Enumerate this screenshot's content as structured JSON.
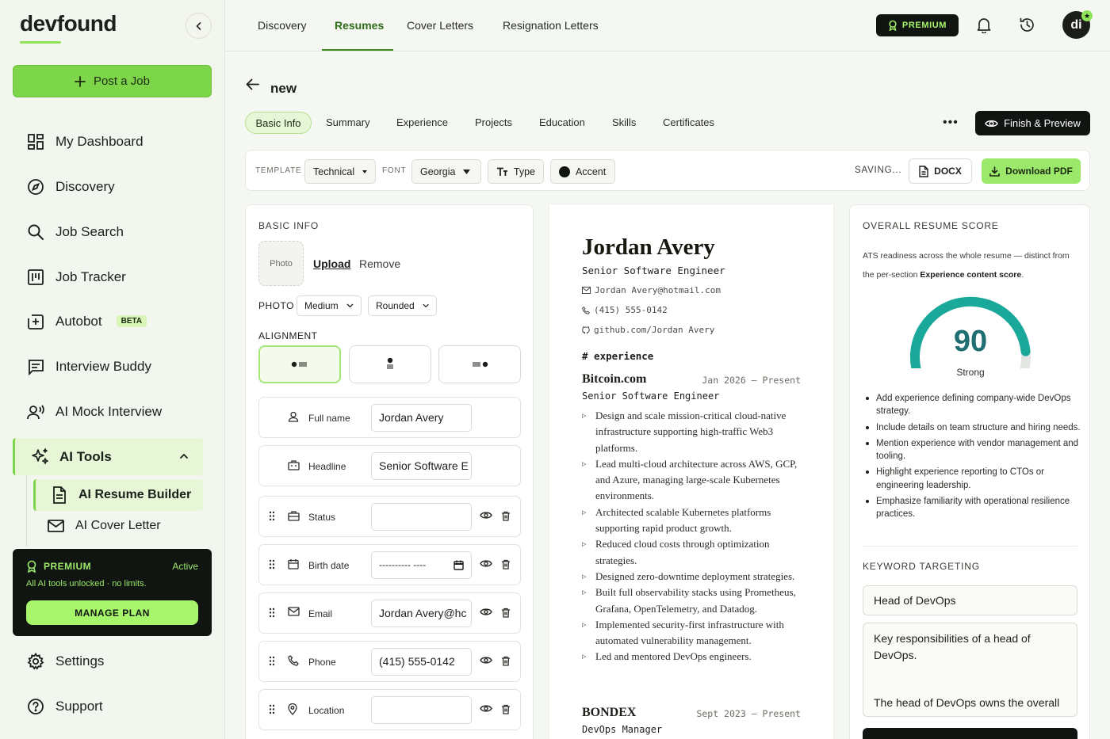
{
  "brand": {
    "name": "devfound"
  },
  "sidebar": {
    "post_job": "Post a Job",
    "items": [
      {
        "label": "My Dashboard",
        "icon": "dashboard-icon"
      },
      {
        "label": "Discovery",
        "icon": "compass-icon"
      },
      {
        "label": "Job Search",
        "icon": "search-icon"
      },
      {
        "label": "Job Tracker",
        "icon": "kanban-icon"
      },
      {
        "label": "Autobot",
        "icon": "plus-square-icon",
        "badge": "BETA"
      },
      {
        "label": "Interview Buddy",
        "icon": "chat-icon"
      },
      {
        "label": "AI Mock Interview",
        "icon": "user-voice-icon"
      }
    ],
    "ai_tools": {
      "label": "AI Tools",
      "sub": [
        {
          "label": "AI Resume Builder"
        },
        {
          "label": "AI Cover Letter"
        }
      ]
    },
    "premium_card": {
      "title": "PREMIUM",
      "status": "Active",
      "subtitle": "All AI tools unlocked · no limits.",
      "button": "MANAGE PLAN"
    },
    "bottom": [
      {
        "label": "Settings",
        "icon": "gear-icon"
      },
      {
        "label": "Support",
        "icon": "help-icon"
      }
    ]
  },
  "topnav": {
    "tabs": [
      "Discovery",
      "Resumes",
      "Cover Letters",
      "Resignation Letters"
    ],
    "active": "Resumes",
    "premium": "PREMIUM",
    "avatar": "di"
  },
  "editor": {
    "doc_name": "new",
    "tabs": [
      "Basic Info",
      "Summary",
      "Experience",
      "Projects",
      "Education",
      "Skills",
      "Certificates"
    ],
    "active_tab": "Basic Info",
    "finish": "Finish & Preview"
  },
  "toolbar": {
    "template_label": "TEMPLATE",
    "template": "Technical",
    "font_label": "FONT",
    "font": "Georgia",
    "type": "Type",
    "accent": "Accent",
    "saving": "SAVING...",
    "docx": "DOCX",
    "pdf": "Download PDF",
    "accent_color": "#111511"
  },
  "basic_info": {
    "title": "BASIC INFO",
    "photo": "Photo",
    "upload": "Upload",
    "remove": "Remove",
    "photo_label": "PHOTO",
    "photo_size": "Medium",
    "photo_shape": "Rounded",
    "alignment_label": "ALIGNMENT",
    "fields": [
      {
        "label": "Full name",
        "value": "Jordan Avery",
        "icon": "user-icon"
      },
      {
        "label": "Headline",
        "value": "Senior Software E",
        "icon": "briefcase-icon"
      },
      {
        "label": "Status",
        "value": "",
        "icon": "bag-icon"
      },
      {
        "label": "Birth date",
        "value": "---------- ----",
        "icon": "calendar-icon"
      },
      {
        "label": "Email",
        "value": "Jordan Avery@hc",
        "icon": "mail-icon"
      },
      {
        "label": "Phone",
        "value": "(415) 555-0142",
        "icon": "phone-icon"
      },
      {
        "label": "Location",
        "value": "",
        "icon": "pin-icon"
      }
    ]
  },
  "preview": {
    "name": "Jordan Avery",
    "title": "Senior Software Engineer",
    "email": "Jordan Avery@hotmail.com",
    "phone": "(415) 555-0142",
    "github": "github.com/Jordan Avery",
    "section": "# experience",
    "jobs": [
      {
        "company": "Bitcoin.com",
        "dates": "Jan 2026 — Present",
        "role": "Senior Software Engineer",
        "bullets": [
          "Design and scale mission-critical cloud-native infrastructure supporting high-traffic Web3 platforms.",
          "Lead multi-cloud architecture across AWS, GCP, and Azure, managing large-scale Kubernetes environments.",
          "Architected scalable Kubernetes platforms supporting rapid product growth.",
          "Reduced cloud costs through optimization strategies.",
          "Designed zero-downtime deployment strategies.",
          "Built full observability stacks using Prometheus, Grafana, OpenTelemetry, and Datadog.",
          "Implemented security-first infrastructure with automated vulnerability management.",
          "Led and mentored DevOps engineers."
        ]
      },
      {
        "company": "BONDEX",
        "dates": "Sept 2023 — Present",
        "role": "DevOps Manager"
      }
    ]
  },
  "score": {
    "title": "OVERALL RESUME SCORE",
    "desc_a": "ATS readiness across the whole resume — distinct from the per-section ",
    "desc_b": "Experience content score",
    "desc_c": ".",
    "value": 90,
    "max": 100,
    "label": "Strong",
    "gauge_color": "#1aa89a",
    "tips": [
      "Add experience defining company-wide DevOps strategy.",
      "Include details on team structure and hiring needs.",
      "Mention experience with vendor management and tooling.",
      "Highlight experience reporting to CTOs or engineering leadership.",
      "Emphasize familiarity with operational resilience practices."
    ],
    "keyword_title": "KEYWORD TARGETING",
    "keyword": "Head of DevOps",
    "keyword_text_1": "Key responsibilities of a head of",
    "keyword_text_2": "DevOps.",
    "keyword_text_3": "The head of DevOps owns the overall"
  }
}
